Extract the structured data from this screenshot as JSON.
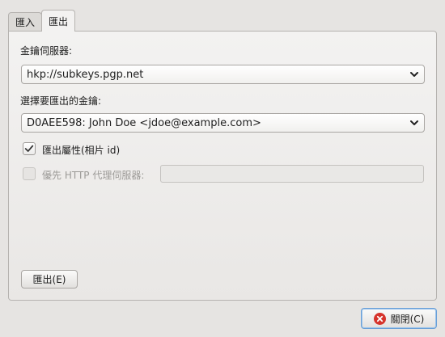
{
  "tabs": [
    {
      "label": "匯入",
      "active": false
    },
    {
      "label": "匯出",
      "active": true
    }
  ],
  "form": {
    "keyserver_label": "金鑰伺服器:",
    "keyserver_value": "hkp://subkeys.pgp.net",
    "key_label": "選擇要匯出的金鑰:",
    "key_value": "D0AEE598: John Doe <jdoe@example.com>",
    "export_attributes_label": "匯出屬性(相片 id)",
    "export_attributes_checked": true,
    "proxy_label": "優先 HTTP 代理伺服器:",
    "proxy_checked": false,
    "proxy_value": ""
  },
  "buttons": {
    "export_label": "匯出(E)",
    "close_label": "關閉(C)"
  },
  "colors": {
    "check_mark": "#333333",
    "close_icon": "#d6342c",
    "focus_ring": "#6aa0d8"
  }
}
